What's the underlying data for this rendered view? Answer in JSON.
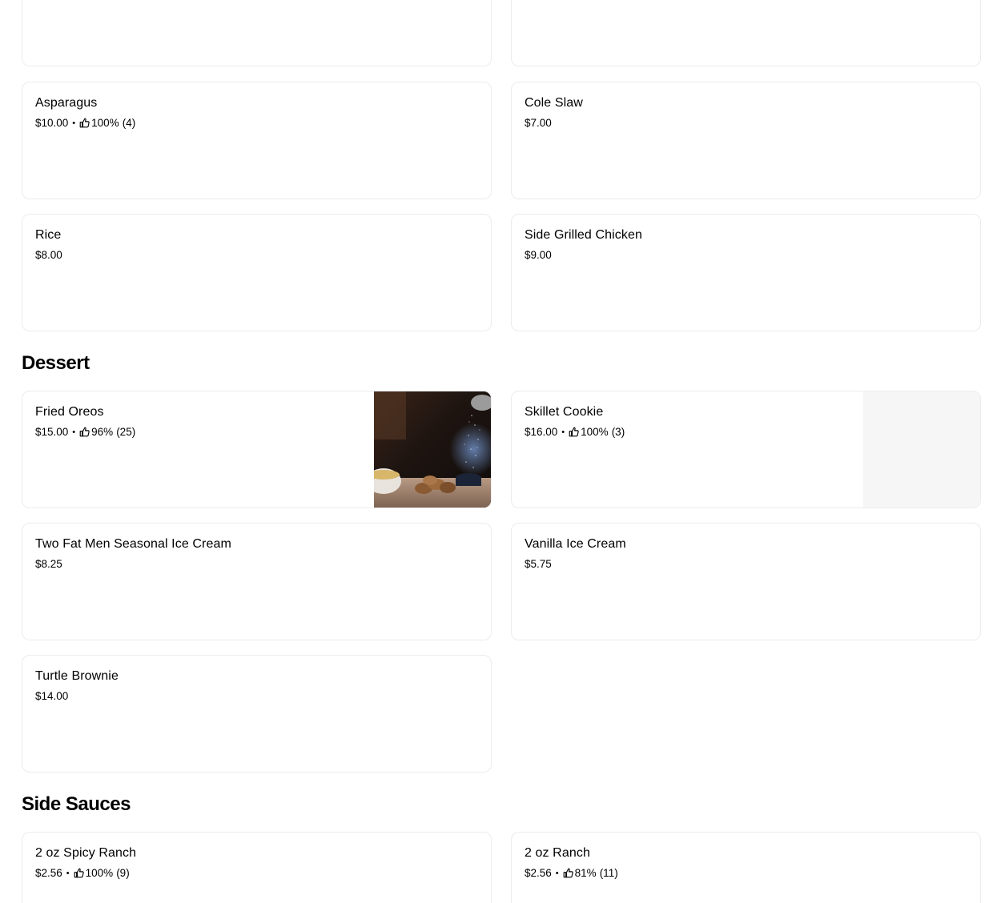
{
  "sections": {
    "dessert_title": "Dessert",
    "side_sauces_title": "Side Sauces"
  },
  "items": {
    "asparagus": {
      "name": "Asparagus",
      "price": "$10.00",
      "rating_pct": "100%",
      "rating_count": "(4)"
    },
    "cole_slaw": {
      "name": "Cole Slaw",
      "price": "$7.00"
    },
    "rice": {
      "name": "Rice",
      "price": "$8.00"
    },
    "side_grilled_chicken": {
      "name": "Side Grilled Chicken",
      "price": "$9.00"
    },
    "fried_oreos": {
      "name": "Fried Oreos",
      "price": "$15.00",
      "rating_pct": "96%",
      "rating_count": "(25)"
    },
    "skillet_cookie": {
      "name": "Skillet Cookie",
      "price": "$16.00",
      "rating_pct": "100%",
      "rating_count": "(3)"
    },
    "two_fat_men": {
      "name": "Two Fat Men Seasonal Ice Cream",
      "price": "$8.25"
    },
    "vanilla_ice_cream": {
      "name": "Vanilla Ice Cream",
      "price": "$5.75"
    },
    "turtle_brownie": {
      "name": "Turtle Brownie",
      "price": "$14.00"
    },
    "spicy_ranch": {
      "name": "2 oz Spicy Ranch",
      "price": "$2.56",
      "rating_pct": "100%",
      "rating_count": "(9)"
    },
    "ranch": {
      "name": "2 oz Ranch",
      "price": "$2.56",
      "rating_pct": "81%",
      "rating_count": "(11)"
    }
  },
  "separator": "•",
  "icons": {
    "rating": "thumbs-up-icon",
    "photo": "food-photo"
  },
  "colors": {
    "border": "#ececec",
    "text": "#000000",
    "placeholder": "#f6f6f6"
  }
}
